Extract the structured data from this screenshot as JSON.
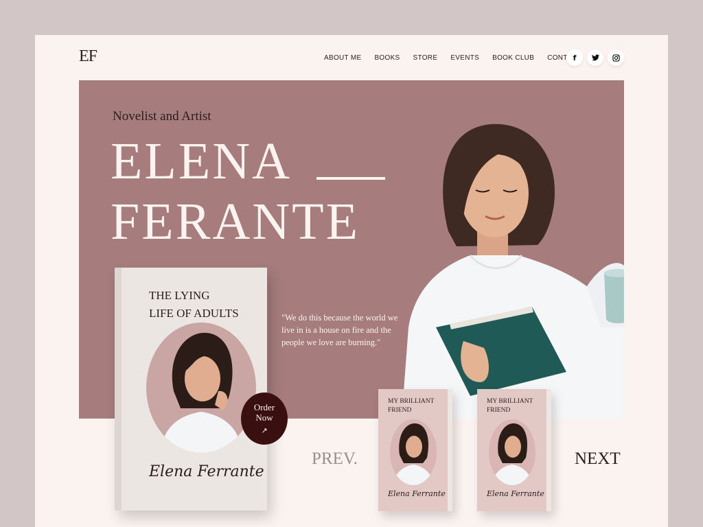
{
  "header": {
    "logo": "EF",
    "nav": [
      "ABOUT ME",
      "BOOKS",
      "STORE",
      "EVENTS",
      "BOOK CLUB",
      "CONTACT"
    ],
    "socials": [
      {
        "icon": "facebook-icon",
        "glyph": "f"
      },
      {
        "icon": "twitter-icon",
        "glyph": "🐦"
      },
      {
        "icon": "instagram-icon",
        "glyph": "◎"
      }
    ]
  },
  "hero": {
    "tagline": "Novelist and Artist",
    "first_name": "ELENA",
    "last_name": "FERANTE",
    "quote": "\"We do this because the world we live in is a house on fire and the people we love are burning.\""
  },
  "featured_book": {
    "title_line1": "THE LYING",
    "title_line2": "LIFE OF ADULTS",
    "signature": "Elena Ferrante",
    "order_label_1": "Order",
    "order_label_2": "Now",
    "order_arrow": "↗"
  },
  "carousel": {
    "prev": "PREV.",
    "next": "NEXT",
    "books": [
      {
        "title_1": "MY BRILLIANT",
        "title_2": "FRIEND",
        "signature": "Elena Ferrante"
      },
      {
        "title_1": "MY BRILLIANT",
        "title_2": "FRIEND",
        "signature": "Elena Ferrante"
      }
    ]
  },
  "colors": {
    "page_bg": "#fbf3f0",
    "outer_bg": "#d3c6c6",
    "hero_bg": "#a67c7c",
    "accent_dark": "#3a0f10",
    "text_dark": "#2a1d1d"
  }
}
